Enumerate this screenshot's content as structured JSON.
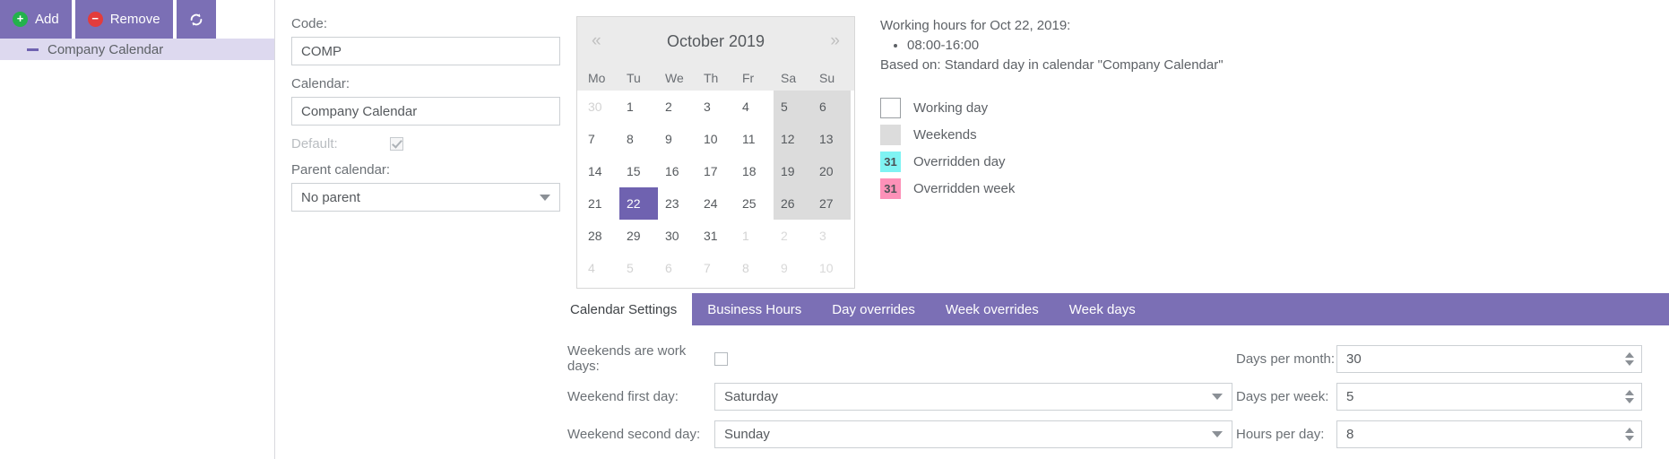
{
  "toolbar": {
    "add_label": "Add",
    "remove_label": "Remove",
    "refresh_label": "",
    "add_icon": "plus-circle-icon",
    "remove_icon": "minus-circle-icon",
    "refresh_icon": "refresh-icon"
  },
  "tree": {
    "items": [
      {
        "label": "Company Calendar",
        "selected": true
      }
    ]
  },
  "form": {
    "code_label": "Code:",
    "code_value": "COMP",
    "calendar_label": "Calendar:",
    "calendar_value": "Company Calendar",
    "default_label": "Default:",
    "default_checked": true,
    "parent_label": "Parent calendar:",
    "parent_value": "No parent"
  },
  "calendar": {
    "prev_label": "«",
    "next_label": "»",
    "title": "October 2019",
    "dow": [
      "Mo",
      "Tu",
      "We",
      "Th",
      "Fr",
      "Sa",
      "Su"
    ],
    "selected_day": 22,
    "weeks": [
      [
        {
          "d": "30",
          "other": true,
          "weekend": false
        },
        {
          "d": "1",
          "other": false,
          "weekend": false
        },
        {
          "d": "2",
          "other": false,
          "weekend": false
        },
        {
          "d": "3",
          "other": false,
          "weekend": false
        },
        {
          "d": "4",
          "other": false,
          "weekend": false
        },
        {
          "d": "5",
          "other": false,
          "weekend": true
        },
        {
          "d": "6",
          "other": false,
          "weekend": true
        }
      ],
      [
        {
          "d": "7",
          "other": false,
          "weekend": false
        },
        {
          "d": "8",
          "other": false,
          "weekend": false
        },
        {
          "d": "9",
          "other": false,
          "weekend": false
        },
        {
          "d": "10",
          "other": false,
          "weekend": false
        },
        {
          "d": "11",
          "other": false,
          "weekend": false
        },
        {
          "d": "12",
          "other": false,
          "weekend": true
        },
        {
          "d": "13",
          "other": false,
          "weekend": true
        }
      ],
      [
        {
          "d": "14",
          "other": false,
          "weekend": false
        },
        {
          "d": "15",
          "other": false,
          "weekend": false
        },
        {
          "d": "16",
          "other": false,
          "weekend": false
        },
        {
          "d": "17",
          "other": false,
          "weekend": false
        },
        {
          "d": "18",
          "other": false,
          "weekend": false
        },
        {
          "d": "19",
          "other": false,
          "weekend": true
        },
        {
          "d": "20",
          "other": false,
          "weekend": true
        }
      ],
      [
        {
          "d": "21",
          "other": false,
          "weekend": false
        },
        {
          "d": "22",
          "other": false,
          "weekend": false,
          "selected": true
        },
        {
          "d": "23",
          "other": false,
          "weekend": false
        },
        {
          "d": "24",
          "other": false,
          "weekend": false
        },
        {
          "d": "25",
          "other": false,
          "weekend": false
        },
        {
          "d": "26",
          "other": false,
          "weekend": true
        },
        {
          "d": "27",
          "other": false,
          "weekend": true
        }
      ],
      [
        {
          "d": "28",
          "other": false,
          "weekend": false
        },
        {
          "d": "29",
          "other": false,
          "weekend": false
        },
        {
          "d": "30",
          "other": false,
          "weekend": false
        },
        {
          "d": "31",
          "other": false,
          "weekend": false
        },
        {
          "d": "1",
          "other": true,
          "weekend": false
        },
        {
          "d": "2",
          "other": true,
          "weekend": true
        },
        {
          "d": "3",
          "other": true,
          "weekend": true
        }
      ],
      [
        {
          "d": "4",
          "other": true,
          "weekend": false
        },
        {
          "d": "5",
          "other": true,
          "weekend": false
        },
        {
          "d": "6",
          "other": true,
          "weekend": false
        },
        {
          "d": "7",
          "other": true,
          "weekend": false
        },
        {
          "d": "8",
          "other": true,
          "weekend": false
        },
        {
          "d": "9",
          "other": true,
          "weekend": true
        },
        {
          "d": "10",
          "other": true,
          "weekend": true
        }
      ]
    ]
  },
  "info": {
    "working_hours_title": "Working hours for Oct 22, 2019:",
    "working_hours": [
      "08:00-16:00"
    ],
    "based_on": "Based on: Standard day in calendar \"Company Calendar\"",
    "legend": [
      {
        "label": "Working day",
        "swatch": "working",
        "text": ""
      },
      {
        "label": "Weekends",
        "swatch": "weekend",
        "text": ""
      },
      {
        "label": "Overridden day",
        "swatch": "oday",
        "text": "31"
      },
      {
        "label": "Overridden week",
        "swatch": "oweek",
        "text": "31"
      }
    ]
  },
  "tabs": [
    {
      "label": "Calendar Settings",
      "active": true
    },
    {
      "label": "Business Hours",
      "active": false
    },
    {
      "label": "Day overrides",
      "active": false
    },
    {
      "label": "Week overrides",
      "active": false
    },
    {
      "label": "Week days",
      "active": false
    }
  ],
  "settings": {
    "left": [
      {
        "label": "Weekends are work days:",
        "type": "checkbox",
        "checked": false
      },
      {
        "label": "Weekend first day:",
        "type": "select",
        "value": "Saturday"
      },
      {
        "label": "Weekend second day:",
        "type": "select",
        "value": "Sunday"
      }
    ],
    "right": [
      {
        "label": "Days per month:",
        "type": "spinner",
        "value": "30"
      },
      {
        "label": "Days per week:",
        "type": "spinner",
        "value": "5"
      },
      {
        "label": "Hours per day:",
        "type": "spinner",
        "value": "8"
      }
    ]
  },
  "colors": {
    "accent_purple": "#7b6fb5",
    "selected_day": "#6f62b0",
    "tree_selected_bg": "#ddd9ef",
    "weekend_gray": "#dcdcdc",
    "overridden_day": "#7ff3f3",
    "overridden_week": "#fd91b8",
    "add_green": "#23b24b",
    "remove_red": "#e33c3c"
  }
}
